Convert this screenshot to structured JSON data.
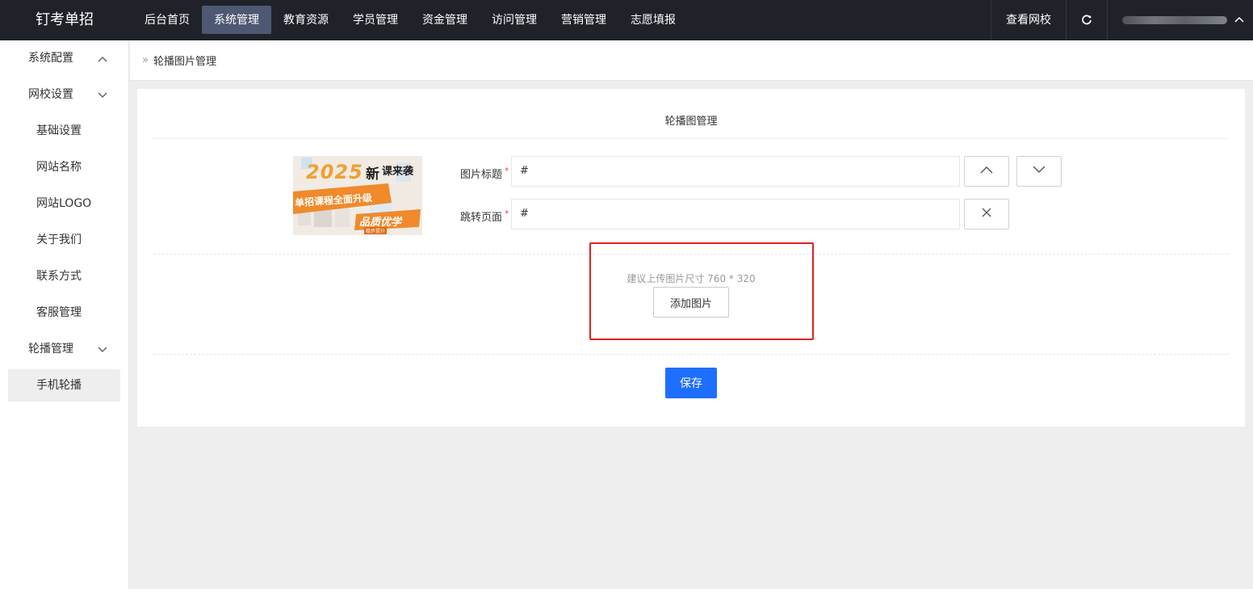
{
  "brand": "钉考单招",
  "nav": {
    "items": [
      {
        "label": "后台首页"
      },
      {
        "label": "系统管理"
      },
      {
        "label": "教育资源"
      },
      {
        "label": "学员管理"
      },
      {
        "label": "资金管理"
      },
      {
        "label": "访问管理"
      },
      {
        "label": "营销管理"
      },
      {
        "label": "志愿填报"
      }
    ],
    "active_index": 1
  },
  "topright": {
    "view_site": "查看网校",
    "refresh_icon": "refresh-icon",
    "user_chevron_icon": "chevron-up-icon"
  },
  "sidebar": {
    "groups": [
      {
        "label": "系统配置",
        "icon": "chevron-up-icon"
      },
      {
        "label": "网校设置",
        "icon": "chevron-down-icon"
      },
      {
        "label": "轮播管理",
        "icon": "chevron-down-icon"
      }
    ],
    "site_items": [
      "基础设置",
      "网站名称",
      "网站LOGO",
      "关于我们",
      "联系方式",
      "客服管理"
    ],
    "carousel_items": [
      "手机轮播"
    ]
  },
  "breadcrumb": {
    "arrows": "»",
    "current": "轮播图片管理"
  },
  "card": {
    "title": "轮播图管理",
    "banner": {
      "year": "2025",
      "tag1": "新",
      "tag2": "课来袭",
      "subtitle": "单招课程全面升级",
      "slogan": "品质优学",
      "footer": "稳步提升"
    },
    "fields": {
      "title_label": "图片标题",
      "title_value": "#",
      "link_label": "跳转页面",
      "link_value": "#",
      "required_mark": "*"
    },
    "hint": "建议上传图片尺寸 760 * 320",
    "add_button": "添加图片",
    "save_button": "保存"
  },
  "colors": {
    "topbar": "#20222a",
    "nav_active": "#4e5872",
    "primary": "#1e6fff",
    "highlight": "#e02020",
    "required": "#ff3c3c"
  }
}
